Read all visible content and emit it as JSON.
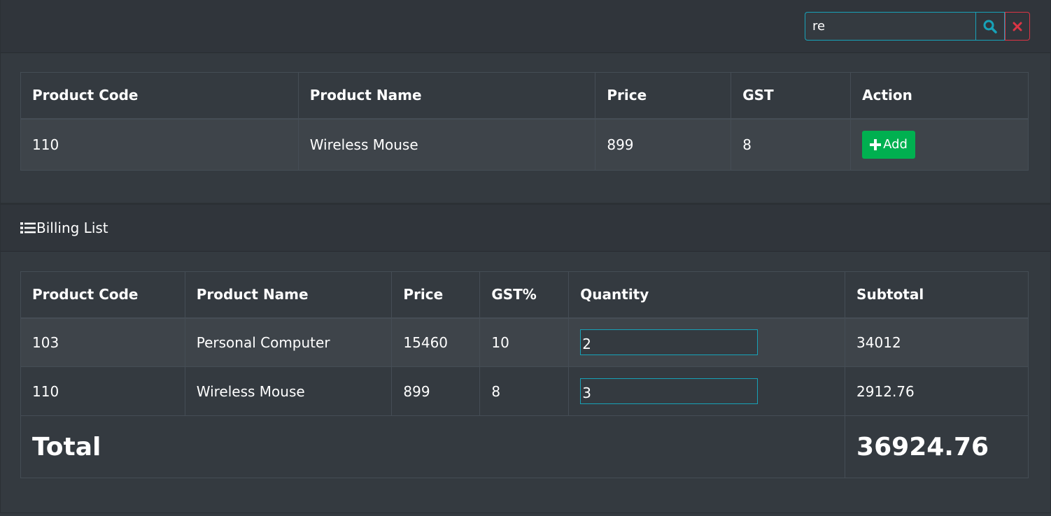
{
  "search": {
    "value": "re",
    "search_icon": "search-icon",
    "clear_icon": "close-icon",
    "accent_color": "#17a2b8",
    "danger_color": "#dc3545"
  },
  "product_table": {
    "headers": [
      "Product Code",
      "Product Name",
      "Price",
      "GST",
      "Action"
    ],
    "rows": [
      {
        "code": "110",
        "name": "Wireless Mouse",
        "price": "899",
        "gst": "8",
        "action_label": "Add"
      }
    ],
    "add_color": "#00b050"
  },
  "billing": {
    "title": "Billing List",
    "icon": "list-icon",
    "headers": [
      "Product Code",
      "Product Name",
      "Price",
      "GST%",
      "Quantity",
      "Subtotal"
    ],
    "rows": [
      {
        "code": "103",
        "name": "Personal Computer",
        "price": "15460",
        "gst": "10",
        "quantity": "2",
        "subtotal": "34012"
      },
      {
        "code": "110",
        "name": "Wireless Mouse",
        "price": "899",
        "gst": "8",
        "quantity": "3",
        "subtotal": "2912.76"
      }
    ],
    "total_label": "Total",
    "total_value": "36924.76"
  }
}
